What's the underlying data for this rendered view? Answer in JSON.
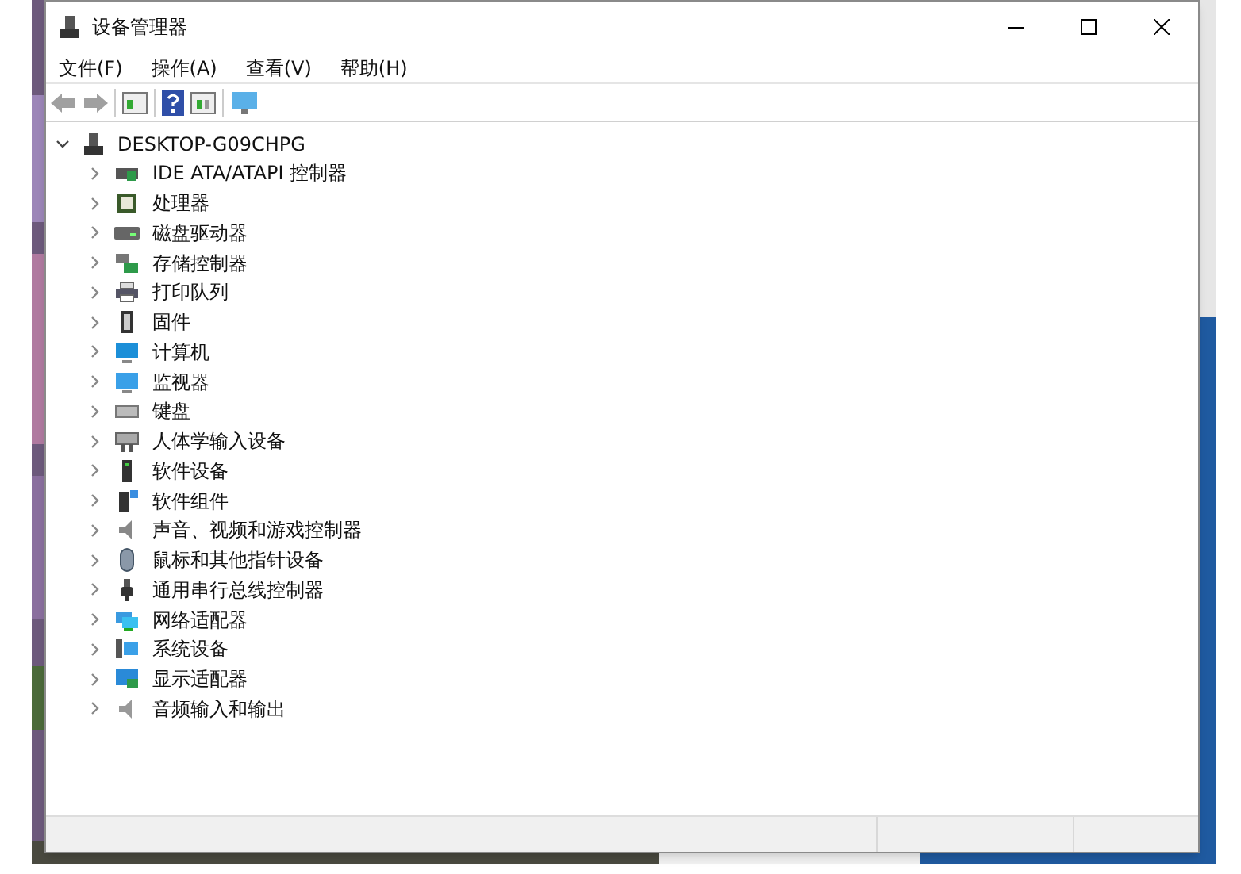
{
  "window": {
    "title": "设备管理器"
  },
  "menu": [
    "文件(F)",
    "操作(A)",
    "查看(V)",
    "帮助(H)"
  ],
  "tree": {
    "label": "DESKTOP-G09CHPG",
    "expanded": true,
    "children": [
      {
        "label": "IDE ATA/ATAPI 控制器",
        "expanded": false
      },
      {
        "label": "处理器",
        "expanded": false
      },
      {
        "label": "磁盘驱动器",
        "expanded": false
      },
      {
        "label": "存储控制器",
        "expanded": false
      },
      {
        "label": "打印队列",
        "expanded": false
      },
      {
        "label": "固件",
        "expanded": false
      },
      {
        "label": "计算机",
        "expanded": false
      },
      {
        "label": "监视器",
        "expanded": false
      },
      {
        "label": "键盘",
        "expanded": false
      },
      {
        "label": "人体学输入设备",
        "expanded": false
      },
      {
        "label": "软件设备",
        "expanded": false
      },
      {
        "label": "软件组件",
        "expanded": false
      },
      {
        "label": "声音、视频和游戏控制器",
        "expanded": false
      },
      {
        "label": "鼠标和其他指针设备",
        "expanded": false
      },
      {
        "label": "通用串行总线控制器",
        "expanded": false
      },
      {
        "label": "网络适配器",
        "expanded": false
      },
      {
        "label": "系统设备",
        "expanded": false
      },
      {
        "label": "显示适配器",
        "expanded": false
      },
      {
        "label": "音频输入和输出",
        "expanded": false
      }
    ]
  }
}
